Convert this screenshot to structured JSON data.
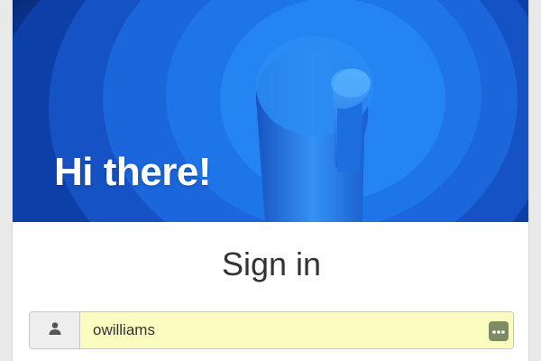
{
  "hero": {
    "title": "Hi there!"
  },
  "form": {
    "title": "Sign in",
    "username": {
      "value": "owilliams",
      "icon": "user-icon"
    },
    "password_manager_icon": "more-dots-icon"
  },
  "colors": {
    "hero_blue": "#1565d8",
    "input_autofill": "#fafcc0",
    "password_manager": "#7d8a64"
  }
}
